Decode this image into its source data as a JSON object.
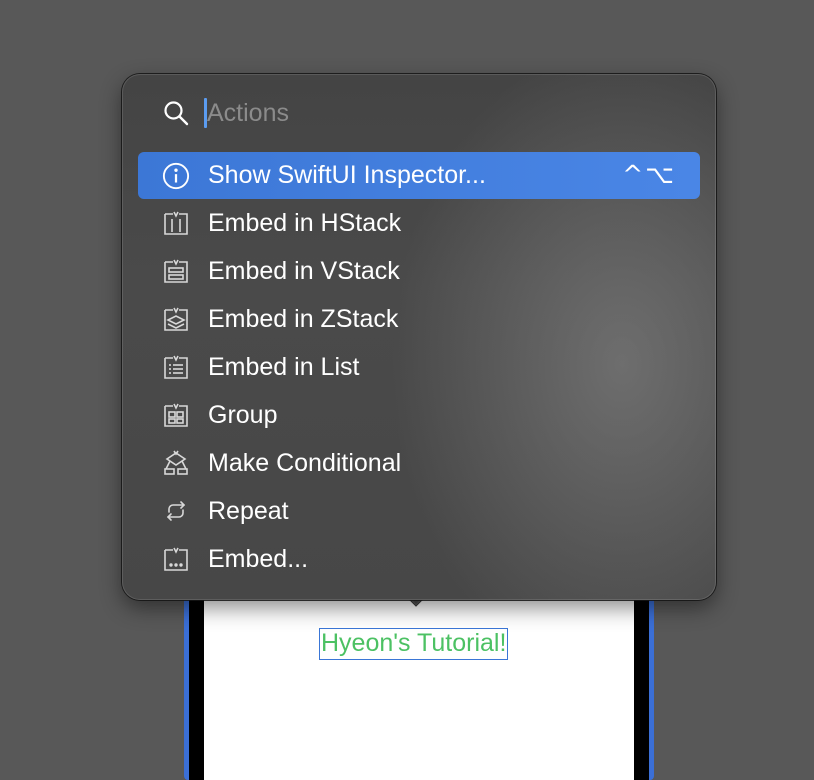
{
  "search": {
    "placeholder": "Actions",
    "icon": "search-icon"
  },
  "menu": {
    "items": [
      {
        "label": "Show SwiftUI Inspector...",
        "icon": "info-icon",
        "shortcut": "^⌥",
        "selected": true
      },
      {
        "label": "Embed in HStack",
        "icon": "hstack-icon"
      },
      {
        "label": "Embed in VStack",
        "icon": "vstack-icon"
      },
      {
        "label": "Embed in ZStack",
        "icon": "zstack-icon"
      },
      {
        "label": "Embed in List",
        "icon": "list-icon"
      },
      {
        "label": "Group",
        "icon": "group-icon"
      },
      {
        "label": "Make Conditional",
        "icon": "conditional-icon"
      },
      {
        "label": "Repeat",
        "icon": "repeat-icon"
      },
      {
        "label": "Embed...",
        "icon": "embed-icon"
      }
    ]
  },
  "preview": {
    "text": "Hyeon's Tutorial!",
    "text_color": "#4cc163"
  },
  "colors": {
    "accent": "#3c77d6",
    "popover_bg": "#474747",
    "backdrop": "#585858"
  }
}
